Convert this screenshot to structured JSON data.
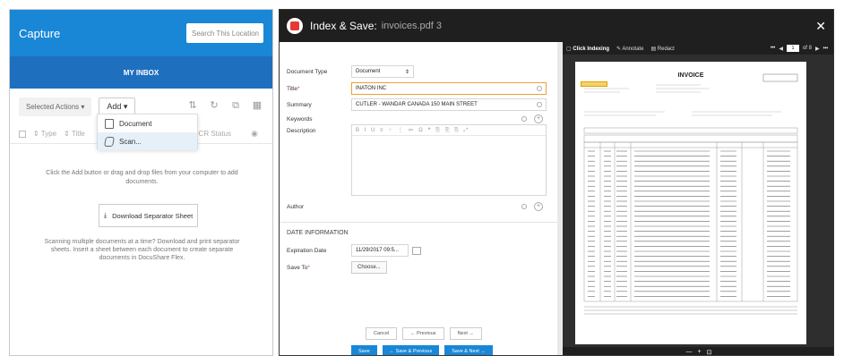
{
  "capture": {
    "title": "Capture",
    "search_placeholder": "Search This Location",
    "inbox_title": "MY INBOX",
    "selected_actions": "Selected Actions",
    "add_label": "Add",
    "col_type": "Type",
    "col_title": "Title",
    "col_ocr": "OCR Status",
    "dropdown": [
      {
        "label": "Document",
        "icon": "document-icon"
      },
      {
        "label": "Scan...",
        "icon": "scan-icon"
      }
    ],
    "empty_message": "Click the Add button or drag and drop files from your computer to add documents.",
    "separator_button": "Download Separator Sheet",
    "scan_message": "Scanning multiple documents at a time? Download and print separator sheets. Insert a sheet between each document to create separate documents in DocuShare Flex."
  },
  "index_save": {
    "title": "Index & Save:",
    "filename": "invoices.pdf 3",
    "toolbar": {
      "click_indexing": "Click Indexing",
      "annotate": "Annotate",
      "redact": "Redact",
      "page_box": "1",
      "page_total": "of 8"
    },
    "form": {
      "document_type_label": "Document Type",
      "document_type_value": "Document",
      "title_label": "Title",
      "title_value": "INATON INC",
      "summary_label": "Summary",
      "summary_value": "CUTLER - WANDAR CANADA 150 MAIN STREET",
      "keywords_label": "Keywords",
      "description_label": "Description",
      "author_label": "Author",
      "date_section": "DATE INFORMATION",
      "expiration_label": "Expiration Date",
      "expiration_value": "11/29/2017 09:5...",
      "save_to_label": "Save To",
      "choose_label": "Choose..."
    },
    "buttons": {
      "cancel": "Cancel",
      "previous": "← Previous",
      "next": "Next →",
      "save": "Save",
      "save_previous": "← Save & Previous",
      "save_next": "Save & Next →"
    },
    "invoice": {
      "title": "INVOICE"
    }
  }
}
